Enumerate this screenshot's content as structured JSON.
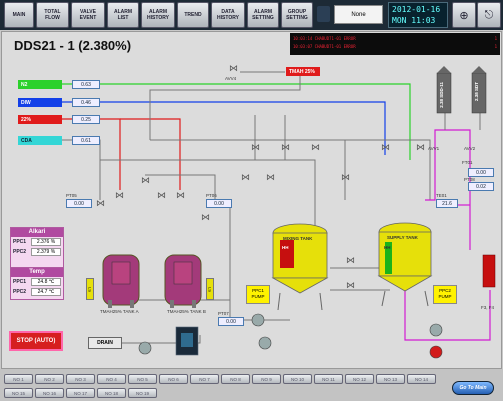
{
  "nav": [
    {
      "label": "MAIN"
    },
    {
      "label": "TOTAL\nFLOW"
    },
    {
      "label": "VALVE\nEVENT"
    },
    {
      "label": "ALARM\nLIST"
    },
    {
      "label": "ALARM\nHISTORY"
    },
    {
      "label": "TREND"
    },
    {
      "label": "DATA\nHISTORY"
    },
    {
      "label": "ALARM\nSETTING"
    },
    {
      "label": "GROUP\nSETTING"
    }
  ],
  "user": {
    "name": "None"
  },
  "clock": {
    "date": "2012-01-16",
    "time": "MON 11:03"
  },
  "page": {
    "title": "DDS21 - 1 (2.380%)"
  },
  "alarms": [
    {
      "text": "10:03:14  CHABUD71-01 ERROR",
      "flag": "1"
    },
    {
      "text": "10:03:07  CHABUD71-01 ERROR",
      "flag": "1"
    }
  ],
  "gases": [
    {
      "name": "N2",
      "reading": "0.63",
      "color": "#2bd12b"
    },
    {
      "name": "DIW",
      "reading": "0.46",
      "color": "#1340e8"
    },
    {
      "name": "22%",
      "reading": "0.25",
      "color": "#e01b1b"
    },
    {
      "name": "CDA",
      "reading": "0.61",
      "color": "#33d6d6"
    }
  ],
  "top_tags": {
    "avv": "AVV4",
    "tmah": "TMAH 25%",
    "avv1": "AVV1",
    "avv2": "AVV2",
    "tank1": "2.38 SDD-11",
    "tank2": "2.38 SDT",
    "ft01": "FT01",
    "pt08": "PT08",
    "pt08_val": "0.02",
    "tt01": "TE01",
    "tt01_val": "21.6",
    "f3": "F3, F4"
  },
  "readings": {
    "pt05": "0.00",
    "pt06": "0.00",
    "pt07": "0.00",
    "ft01_val": "0.00"
  },
  "alkari": {
    "title": "Alkari",
    "ppc1": "2.376 %",
    "ppc2": "2.379 %"
  },
  "temp": {
    "title": "Temp",
    "ppc1": "24.8 ℃",
    "ppc2": "24.7 ℃"
  },
  "tanks": {
    "tank_a": "TMAH25% TANK A",
    "tank_b": "TMAH25% TANK B",
    "mixing": "MIXING TANK",
    "supply": "SUPPLY TANK",
    "mixing_hh": "HH",
    "supply_hh": "HH"
  },
  "pumps": {
    "ppc1": "PPC1\nPUMP",
    "ppc2": "PPC2\nPUMP"
  },
  "buttons": {
    "stop": "STOP (AUTO)",
    "drain": "DRAIN",
    "goto_main": "Go To Main"
  },
  "bottom_tabs_row1": [
    "NO 1",
    "NO 2",
    "NO 3",
    "NO 4",
    "NO 5",
    "NO 6",
    "NO 7",
    "NO 8",
    "NO 9",
    "NO 10",
    "NO 11",
    "NO 12",
    "NO 13",
    "NO 14"
  ],
  "bottom_tabs_row2": [
    "NO 15",
    "NO 16",
    "NO 17",
    "NO 18",
    "NO 19"
  ],
  "colors": {
    "tmah_pipe": "#e01b1b",
    "diw_pipe": "#1340e8",
    "n2_pipe": "#2bd12b",
    "supply_pipe": "#d21bd2",
    "tank": "#e6e00a",
    "tank_vessel": "#a33a7a"
  }
}
